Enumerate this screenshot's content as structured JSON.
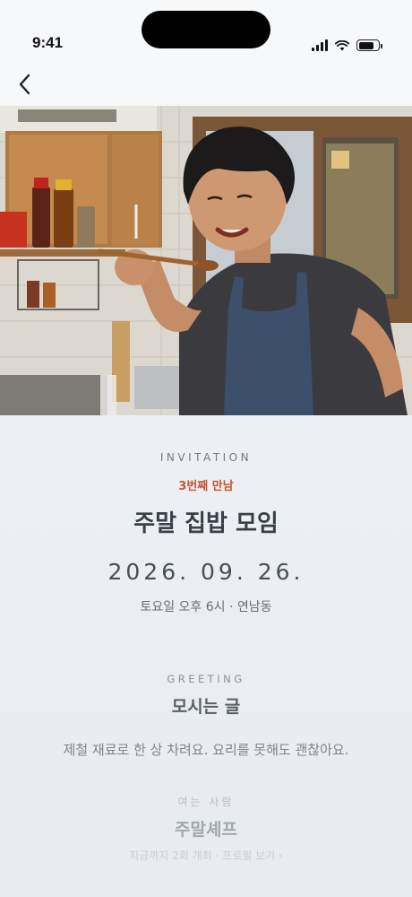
{
  "status_bar": {
    "time": "9:41"
  },
  "hero": {
    "icon": "photo-chef-tasting"
  },
  "invite": {
    "label": "INVITATION",
    "meeting_number": "3번째 만남",
    "title": "주말 집밥 모임",
    "date": "2026. 09. 26.",
    "time_location": "토요일 오후 6시 · 연남동"
  },
  "greeting": {
    "label": "GREETING",
    "title": "모시는 글",
    "body": "제철 재료로 한 상 차려요. 요리를 못해도 괜찮아요."
  },
  "host": {
    "label": "여는 사람",
    "name": "주말셰프",
    "count_text": "지금까지 2회 개최",
    "separator": " · ",
    "profile_link": "프로필 보기 ›"
  },
  "colors": {
    "accent": "#c4552e",
    "text_primary": "#3b4048",
    "background": "#eef1f5"
  }
}
